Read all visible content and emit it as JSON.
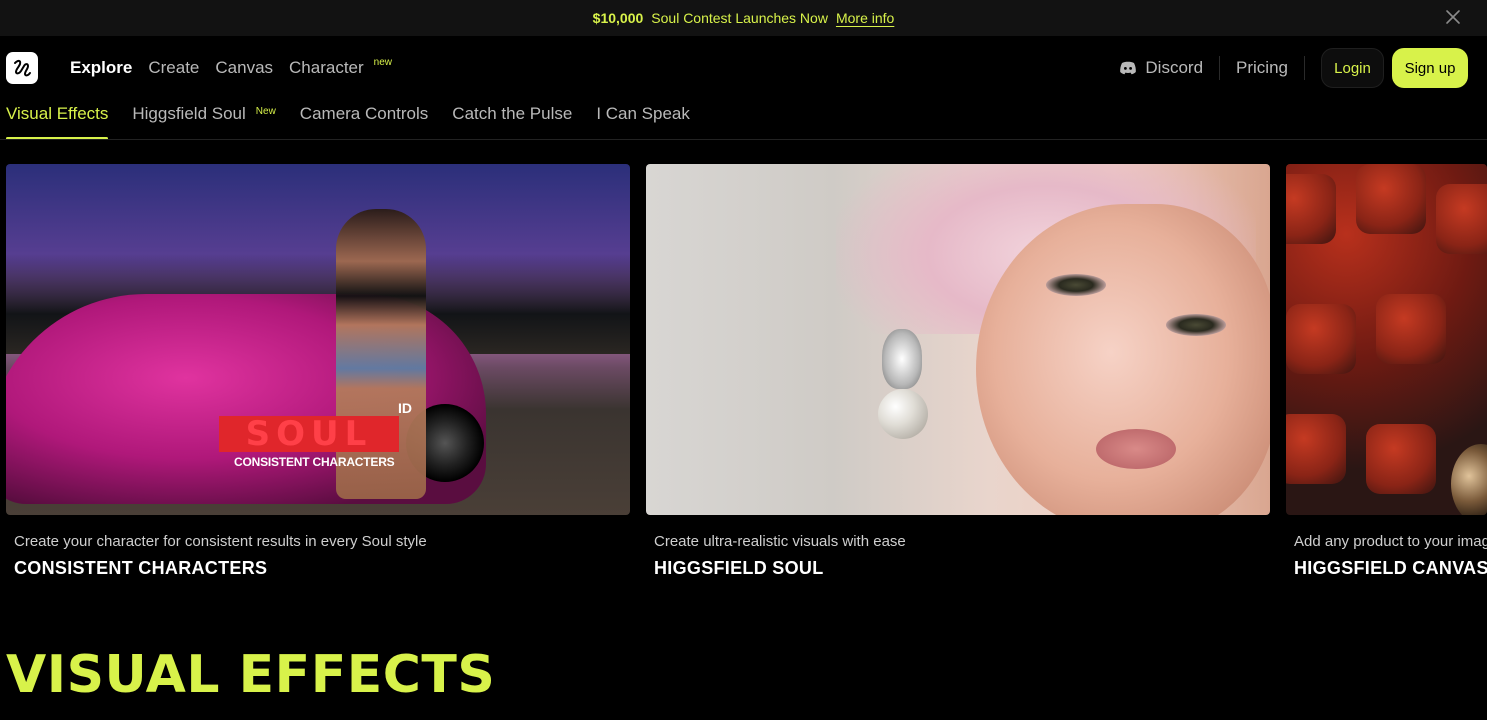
{
  "announcement": {
    "amount": "$10,000",
    "text": "Soul Contest Launches Now",
    "link": "More info"
  },
  "header": {
    "nav": [
      {
        "label": "Explore",
        "active": true
      },
      {
        "label": "Create"
      },
      {
        "label": "Canvas"
      },
      {
        "label": "Character",
        "badge": "new"
      }
    ],
    "discord": "Discord",
    "pricing": "Pricing",
    "login": "Login",
    "signup": "Sign up"
  },
  "tabs": [
    {
      "label": "Visual Effects",
      "active": true
    },
    {
      "label": "Higgsfield Soul",
      "badge": "New"
    },
    {
      "label": "Camera Controls"
    },
    {
      "label": "Catch the Pulse"
    },
    {
      "label": "I Can Speak"
    }
  ],
  "cards": [
    {
      "description": "Create your character for consistent results in every Soul style",
      "title": "CONSISTENT CHARACTERS",
      "overlay": {
        "logo": "SOUL",
        "id": "ID",
        "subtitle": "CONSISTENT CHARACTERS"
      }
    },
    {
      "description": "Create ultra-realistic visuals with ease",
      "title": "HIGGSFIELD SOUL"
    },
    {
      "description": "Add any product to your imag",
      "title": "HIGGSFIELD CANVAS"
    }
  ],
  "section_title": "VISUAL EFFECTS",
  "colors": {
    "accent": "#d8f24a",
    "background": "#000000"
  },
  "icons": {
    "logo": "higgsfield-logo-icon",
    "close": "close-icon",
    "discord": "discord-icon"
  }
}
